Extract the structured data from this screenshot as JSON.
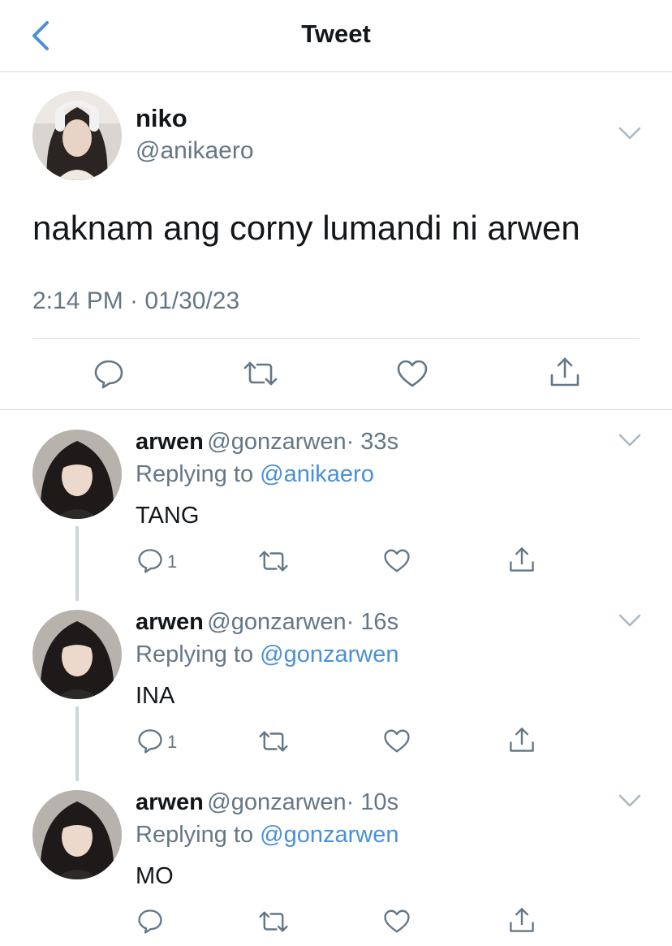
{
  "header": {
    "title": "Tweet"
  },
  "tweet": {
    "name": "niko",
    "handle": "@anikaero",
    "text": "naknam ang corny lumandi ni arwen",
    "timestamp": "2:14 PM · 01/30/23"
  },
  "replies": [
    {
      "name": "arwen",
      "handle": "@gonzarwen",
      "time": "· 33s",
      "replying_label": "Replying to",
      "replying_to": "@anikaero",
      "text": "TANG",
      "reply_count": "1"
    },
    {
      "name": "arwen",
      "handle": "@gonzarwen",
      "time": "· 16s",
      "replying_label": "Replying to",
      "replying_to": "@gonzarwen",
      "text": "INA",
      "reply_count": "1"
    },
    {
      "name": "arwen",
      "handle": "@gonzarwen",
      "time": "· 10s",
      "replying_label": "Replying to",
      "replying_to": "@gonzarwen",
      "text": "MO",
      "reply_count": ""
    }
  ],
  "colors": {
    "accent": "#4a90d9",
    "muted": "#657786",
    "divider": "#d6d9dc"
  },
  "icons": [
    "chevron-left-icon",
    "chevron-down-icon",
    "reply-icon",
    "retweet-icon",
    "like-icon",
    "share-icon"
  ]
}
